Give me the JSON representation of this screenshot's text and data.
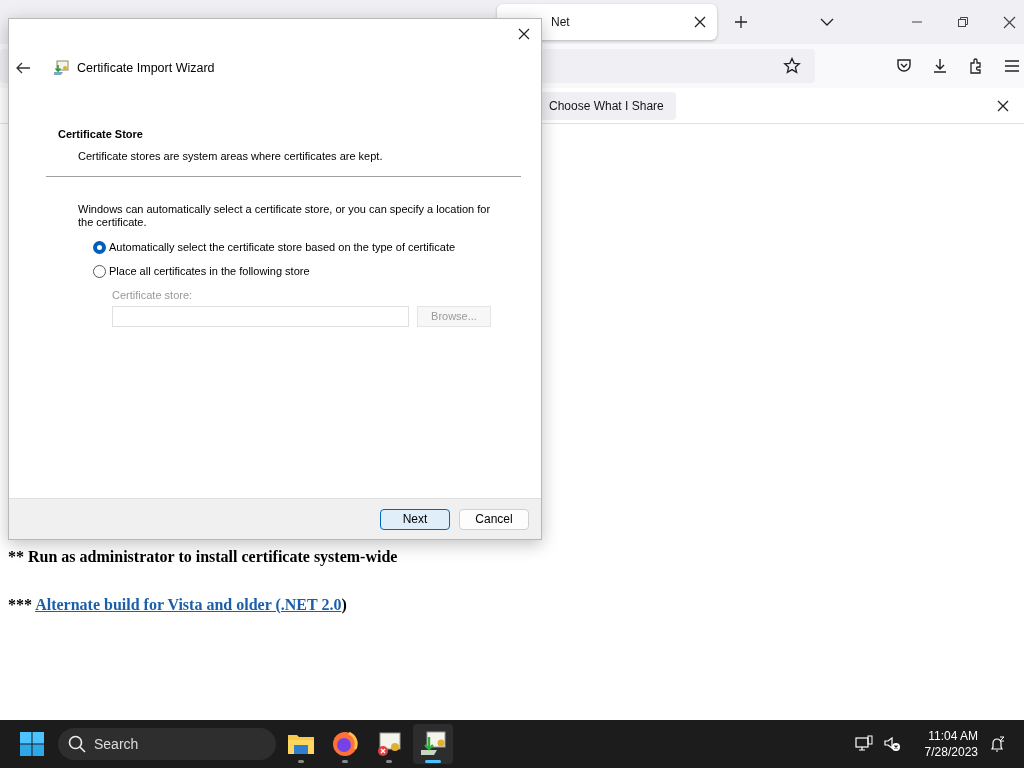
{
  "browser": {
    "tab": {
      "title": "Net",
      "selected": true
    },
    "notification": {
      "button": "Choose What I Share"
    }
  },
  "page": {
    "note": "** Run as administrator to install certificate system-wide",
    "alt": {
      "prefix": "***",
      "link": "Alternate build for Vista and older (.NET 2.0",
      "suffix": ")"
    }
  },
  "dialog": {
    "title": "Certificate Import Wizard",
    "heading": "Certificate Store",
    "subheading": "Certificate stores are system areas where certificates are kept.",
    "intro": "Windows can automatically select a certificate store, or you can specify a location for the certificate.",
    "options": [
      {
        "label": "Automatically select the certificate store based on the type of certificate",
        "selected": true
      },
      {
        "label": "Place all certificates in the following store",
        "selected": false
      }
    ],
    "store": {
      "label": "Certificate store:",
      "button": "Browse...",
      "disabled": true
    },
    "buttons": [
      {
        "label": "Next",
        "default": true
      },
      {
        "label": "Cancel",
        "default": false
      }
    ]
  },
  "taskbar": {
    "search_placeholder": "Search",
    "apps": [
      {
        "kind": "folder",
        "active": false
      },
      {
        "kind": "browser",
        "active": false
      },
      {
        "kind": "cert-error",
        "active": false
      },
      {
        "kind": "cert-import",
        "active": true
      }
    ],
    "time": "11:04 AM",
    "date": "7/28/2023"
  }
}
